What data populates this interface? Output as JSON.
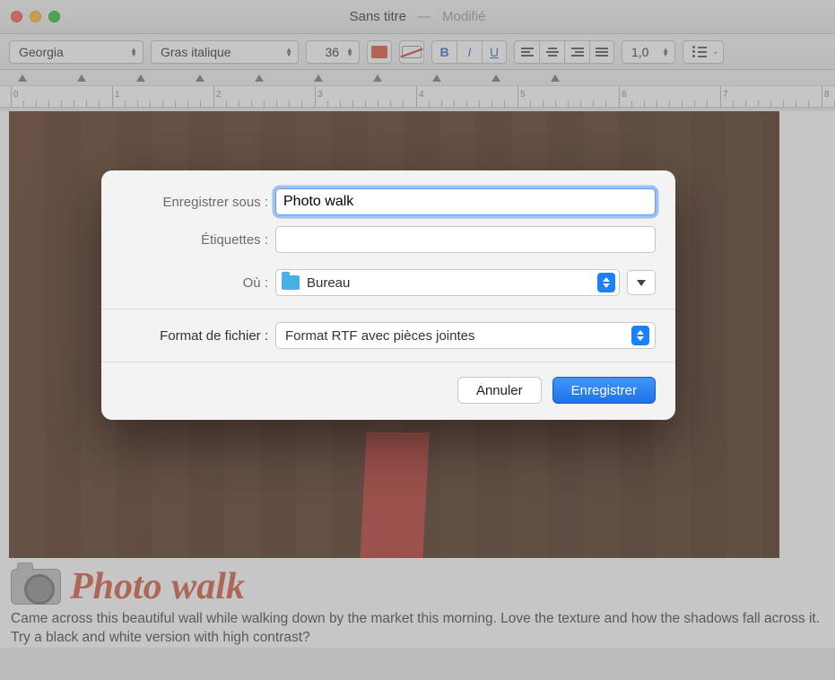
{
  "window": {
    "title_main": "Sans titre",
    "title_sep": "—",
    "title_status": "Modifié"
  },
  "toolbar": {
    "font_family": "Georgia",
    "font_style": "Gras italique",
    "font_size": "36",
    "bold": "B",
    "italic": "I",
    "underline": "U",
    "line_spacing": "1,0"
  },
  "ruler": {
    "marks": [
      "0",
      "1",
      "2",
      "3",
      "4",
      "5",
      "6",
      "7",
      "8"
    ]
  },
  "document": {
    "heading": "Photo walk",
    "paragraph": "Came across this beautiful wall while walking down by the market this morning. Love the texture and how the shadows fall across it. Try a black and white version with high contrast?"
  },
  "dialog": {
    "save_as_label": "Enregistrer sous :",
    "save_as_value": "Photo walk",
    "tags_label": "Étiquettes :",
    "tags_value": "",
    "where_label": "Où :",
    "where_value": "Bureau",
    "format_label": "Format de fichier :",
    "format_value": "Format RTF avec pièces jointes",
    "cancel": "Annuler",
    "save": "Enregistrer"
  }
}
